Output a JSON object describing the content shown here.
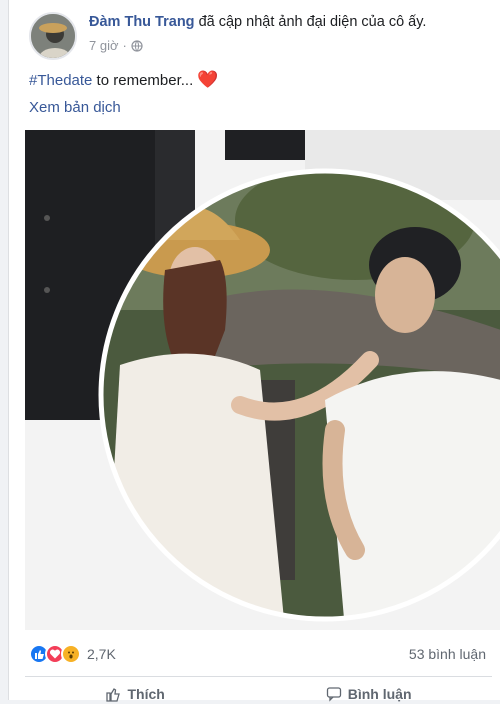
{
  "post": {
    "author_name": "Đàm Thu Trang",
    "action_text": "đã cập nhật ảnh đại diện của cô ấy.",
    "time": "7 giờ",
    "privacy_icon": "globe-icon",
    "caption_hashtag": "#Thedate",
    "caption_text": " to remember...",
    "caption_emoji": "❤️",
    "translate_label": "Xem bản dịch"
  },
  "reactions": {
    "icons": [
      "like-icon",
      "love-icon",
      "wow-icon"
    ],
    "count": "2,7K",
    "comments": "53 bình luận"
  },
  "actions": {
    "like_label": "Thích",
    "comment_label": "Bình luận"
  },
  "colors": {
    "link": "#385898",
    "like": "#1877f2",
    "love": "#f33e58",
    "wow": "#f7b125"
  }
}
